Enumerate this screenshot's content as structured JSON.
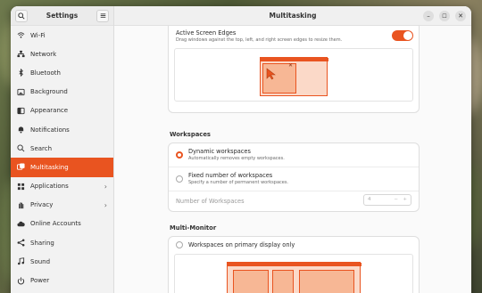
{
  "sidebar": {
    "title": "Settings",
    "items": [
      {
        "label": "Wi-Fi",
        "icon": "wifi-icon"
      },
      {
        "label": "Network",
        "icon": "network-icon"
      },
      {
        "label": "Bluetooth",
        "icon": "bluetooth-icon"
      },
      {
        "label": "Background",
        "icon": "background-icon"
      },
      {
        "label": "Appearance",
        "icon": "appearance-icon"
      },
      {
        "label": "Notifications",
        "icon": "bell-icon"
      },
      {
        "label": "Search",
        "icon": "search-icon"
      },
      {
        "label": "Multitasking",
        "icon": "multitasking-icon",
        "active": true
      },
      {
        "label": "Applications",
        "icon": "applications-icon",
        "chevron": true
      },
      {
        "label": "Privacy",
        "icon": "hand-icon",
        "chevron": true
      },
      {
        "label": "Online Accounts",
        "icon": "cloud-icon"
      },
      {
        "label": "Sharing",
        "icon": "share-icon"
      },
      {
        "label": "Sound",
        "icon": "music-icon"
      },
      {
        "label": "Power",
        "icon": "power-icon"
      }
    ]
  },
  "window": {
    "title": "Multitasking"
  },
  "edges": {
    "title": "Active Screen Edges",
    "subtitle": "Drag windows against the top, left, and right screen edges to resize them.",
    "enabled": true
  },
  "workspaces": {
    "heading": "Workspaces",
    "dynamic_title": "Dynamic workspaces",
    "dynamic_sub": "Automatically removes empty workspaces.",
    "fixed_title": "Fixed number of workspaces",
    "fixed_sub": "Specify a number of permanent workspaces.",
    "number_label": "Number of Workspaces",
    "number_value": "4"
  },
  "multimonitor": {
    "heading": "Multi-Monitor",
    "primary_title": "Workspaces on primary display only"
  },
  "colors": {
    "accent": "#e95420",
    "preview_bg": "#fbd9c8"
  }
}
